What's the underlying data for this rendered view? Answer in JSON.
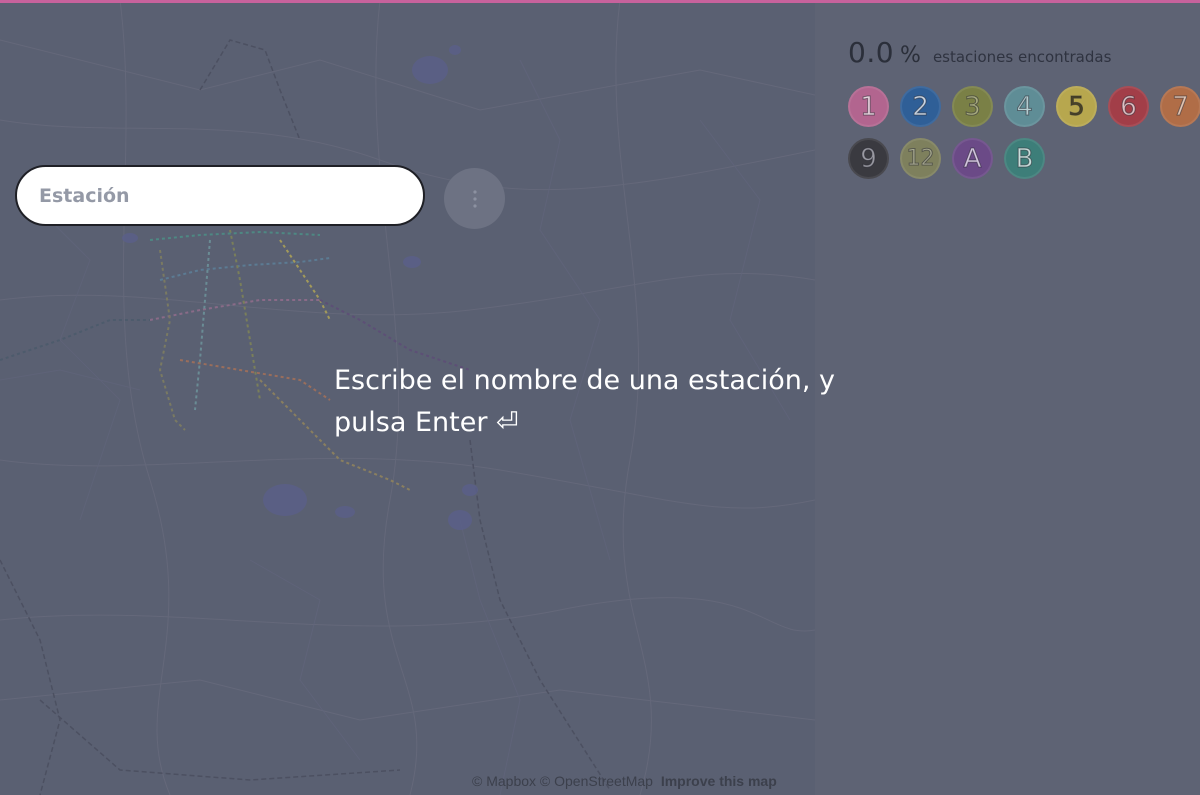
{
  "search": {
    "placeholder": "Estación",
    "menu_icon": "more-vertical-icon"
  },
  "instructions": {
    "text": "Escribe el nombre de una estación, y pulsa Enter ⏎"
  },
  "progress": {
    "value": "0.0",
    "unit": "%",
    "label": "estaciones encontradas"
  },
  "lines": [
    {
      "label": "1",
      "color": "#b2658f",
      "text_color": "#ead3df"
    },
    {
      "label": "2",
      "color": "#2f5f97",
      "text_color": "#c8d6e6"
    },
    {
      "label": "3",
      "color": "#7a8046",
      "text_color": "#a9ad7e"
    },
    {
      "label": "4",
      "color": "#5f8d96",
      "text_color": "#b3cdd1"
    },
    {
      "label": "5",
      "color": "#b7a74e",
      "text_color": "#4b4424"
    },
    {
      "label": "6",
      "color": "#a23e48",
      "text_color": "#e2bfc3"
    },
    {
      "label": "7",
      "color": "#b06d47",
      "text_color": "#e4c5b2"
    },
    {
      "label": "9",
      "color": "#3a3a40",
      "text_color": "#9a9aa2"
    },
    {
      "label": "12",
      "color": "#7e805d",
      "text_color": "#a9ab8f"
    },
    {
      "label": "A",
      "color": "#6b4a87",
      "text_color": "#d6c7e2"
    },
    {
      "label": "B",
      "color": "#3d7e79",
      "text_color": "#c7dedb"
    }
  ],
  "attribution": {
    "mapbox": "© Mapbox",
    "osm": "© OpenStreetMap",
    "improve": "Improve this map"
  }
}
